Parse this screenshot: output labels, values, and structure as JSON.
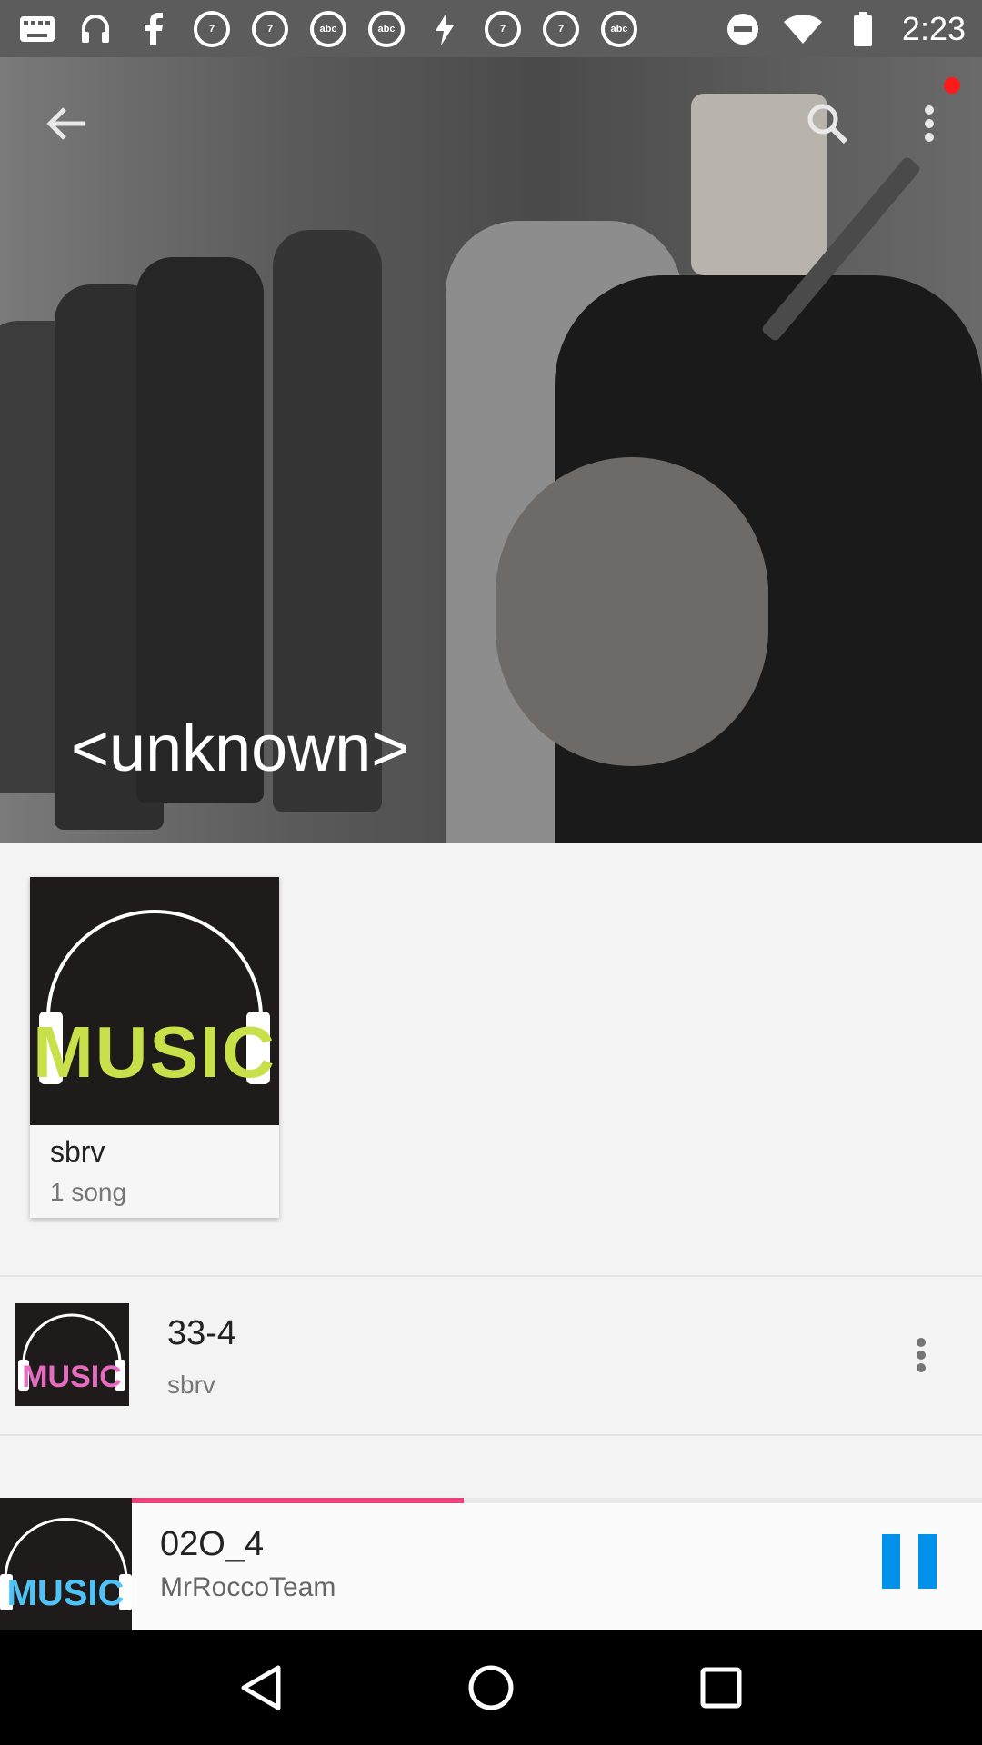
{
  "status_bar": {
    "time": "2:23",
    "icons": [
      "keyboard-icon",
      "headphones-icon",
      "facebook-icon",
      "abc-7-icon",
      "abc-7-icon",
      "abc-icon",
      "abc-icon",
      "bolt-icon",
      "abc-7-icon",
      "abc-7-icon",
      "abc-icon",
      "do-not-disturb-icon",
      "wifi-icon",
      "battery-icon"
    ]
  },
  "hero": {
    "title": "<unknown>"
  },
  "album": {
    "name": "sbrv",
    "count": "1 song"
  },
  "songs": [
    {
      "title": "33-4",
      "artist": "sbrv"
    }
  ],
  "now_playing": {
    "title": "02O_4",
    "artist": "MrRoccoTeam",
    "progress_fraction": 0.39
  },
  "colors": {
    "accent": "#ec407a",
    "pause": "#0091ea"
  }
}
